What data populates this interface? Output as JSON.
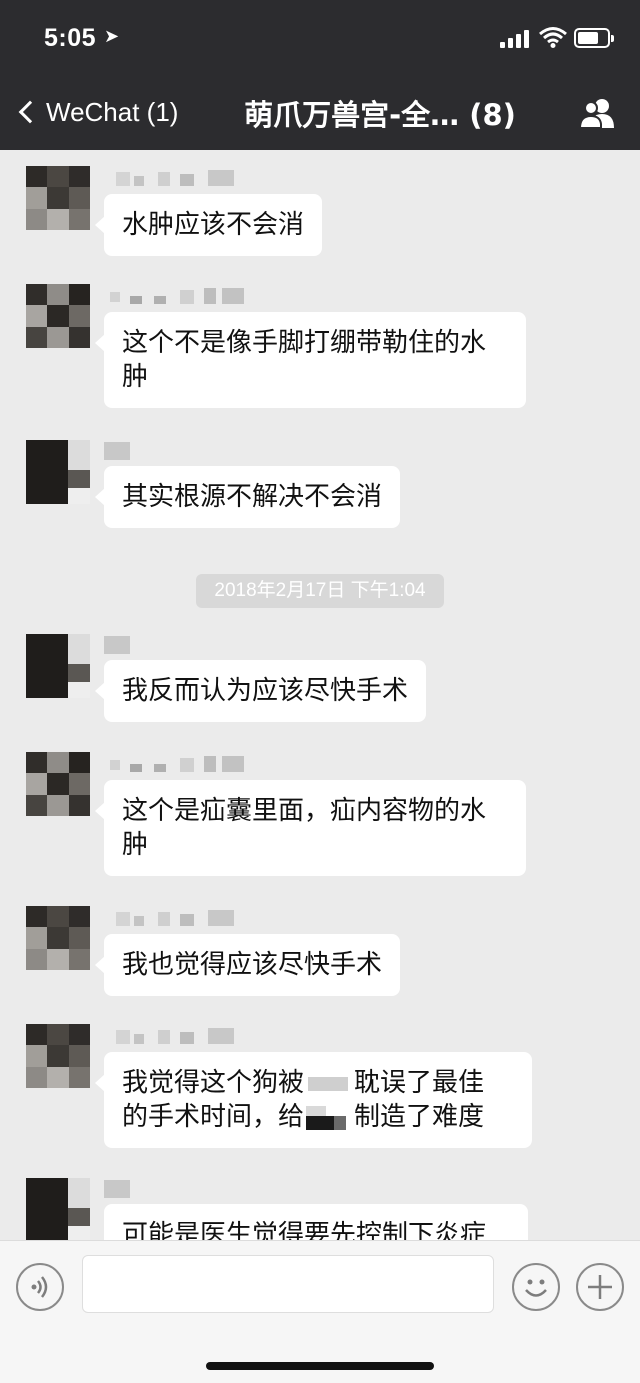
{
  "status_bar": {
    "time": "5:05",
    "location_glyph": "➤"
  },
  "nav": {
    "back_label": "WeChat (1)",
    "title": "萌爪万兽宫-全… (8)",
    "members_icon": "group-members-icon"
  },
  "messages": [
    {
      "text": "水肿应该不会消"
    },
    {
      "text": "这个不是像手脚打绷带勒住的水\n肿"
    },
    {
      "text": "其实根源不解决不会消"
    },
    {
      "text": "我反而认为应该尽快手术"
    },
    {
      "text": "这个是疝囊里面，疝内容物的水\n肿"
    },
    {
      "text": "我也觉得应该尽快手术"
    },
    {
      "part1": "我觉得这个狗被",
      "part2": "耽误了最佳",
      "part3": "的手术时间，给",
      "part4": "制造了难度"
    },
    {
      "text": "可能是医生觉得要先控制下炎症"
    }
  ],
  "timestamp": "2018年2月17日 下午1:04",
  "input_bar": {
    "voice_icon": "voice-icon",
    "emoji_icon": "emoji-icon",
    "plus_icon": "plus-icon"
  },
  "colors": {
    "header_bg": "#2c2c2f",
    "chat_bg": "#ebebeb",
    "bubble_bg": "#ffffff"
  }
}
